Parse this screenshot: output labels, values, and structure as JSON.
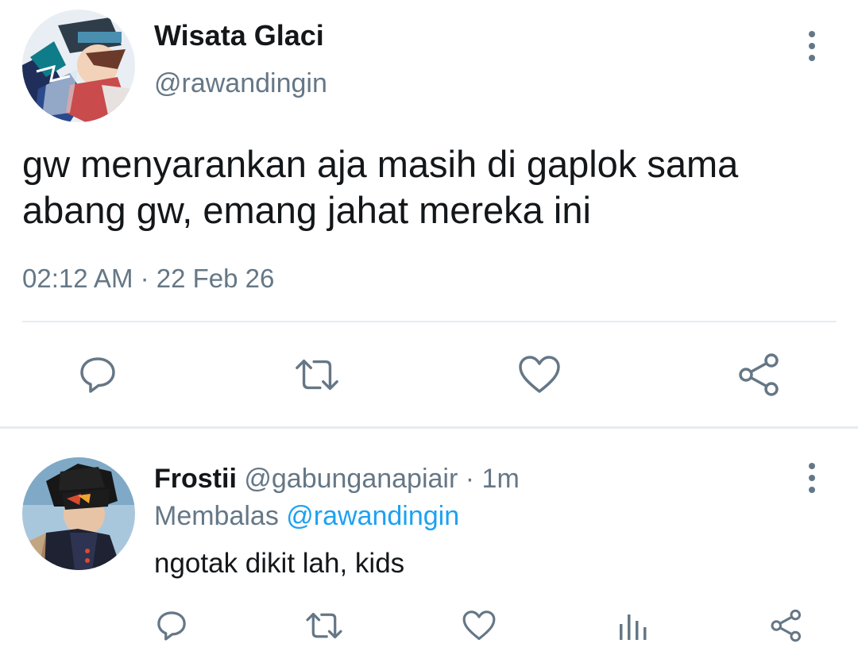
{
  "main_tweet": {
    "author": {
      "name": "Wisata Glaci",
      "handle": "@rawandingin"
    },
    "text_line1": "gw menyarankan aja masih di gaplok sama",
    "text_line2": "abang gw, emang jahat mereka ini",
    "timestamp": "02:12 AM · 22 Feb 26",
    "actions": [
      "reply-icon",
      "retweet-icon",
      "like-icon",
      "share-icon"
    ]
  },
  "reply": {
    "author": {
      "name": "Frostii",
      "handle": "@gabunganapiair"
    },
    "separator": " · ",
    "age": "1m",
    "replying_prefix": "Membalas ",
    "replying_to": "@rawandingin",
    "text": "ngotak dikit lah, kids",
    "actions": [
      "reply-icon",
      "retweet-icon",
      "like-icon",
      "analytics-icon",
      "share-icon"
    ]
  },
  "colors": {
    "text": "#14171a",
    "secondary": "#657786",
    "link": "#1da1f2",
    "divider": "#e6ecf0"
  }
}
